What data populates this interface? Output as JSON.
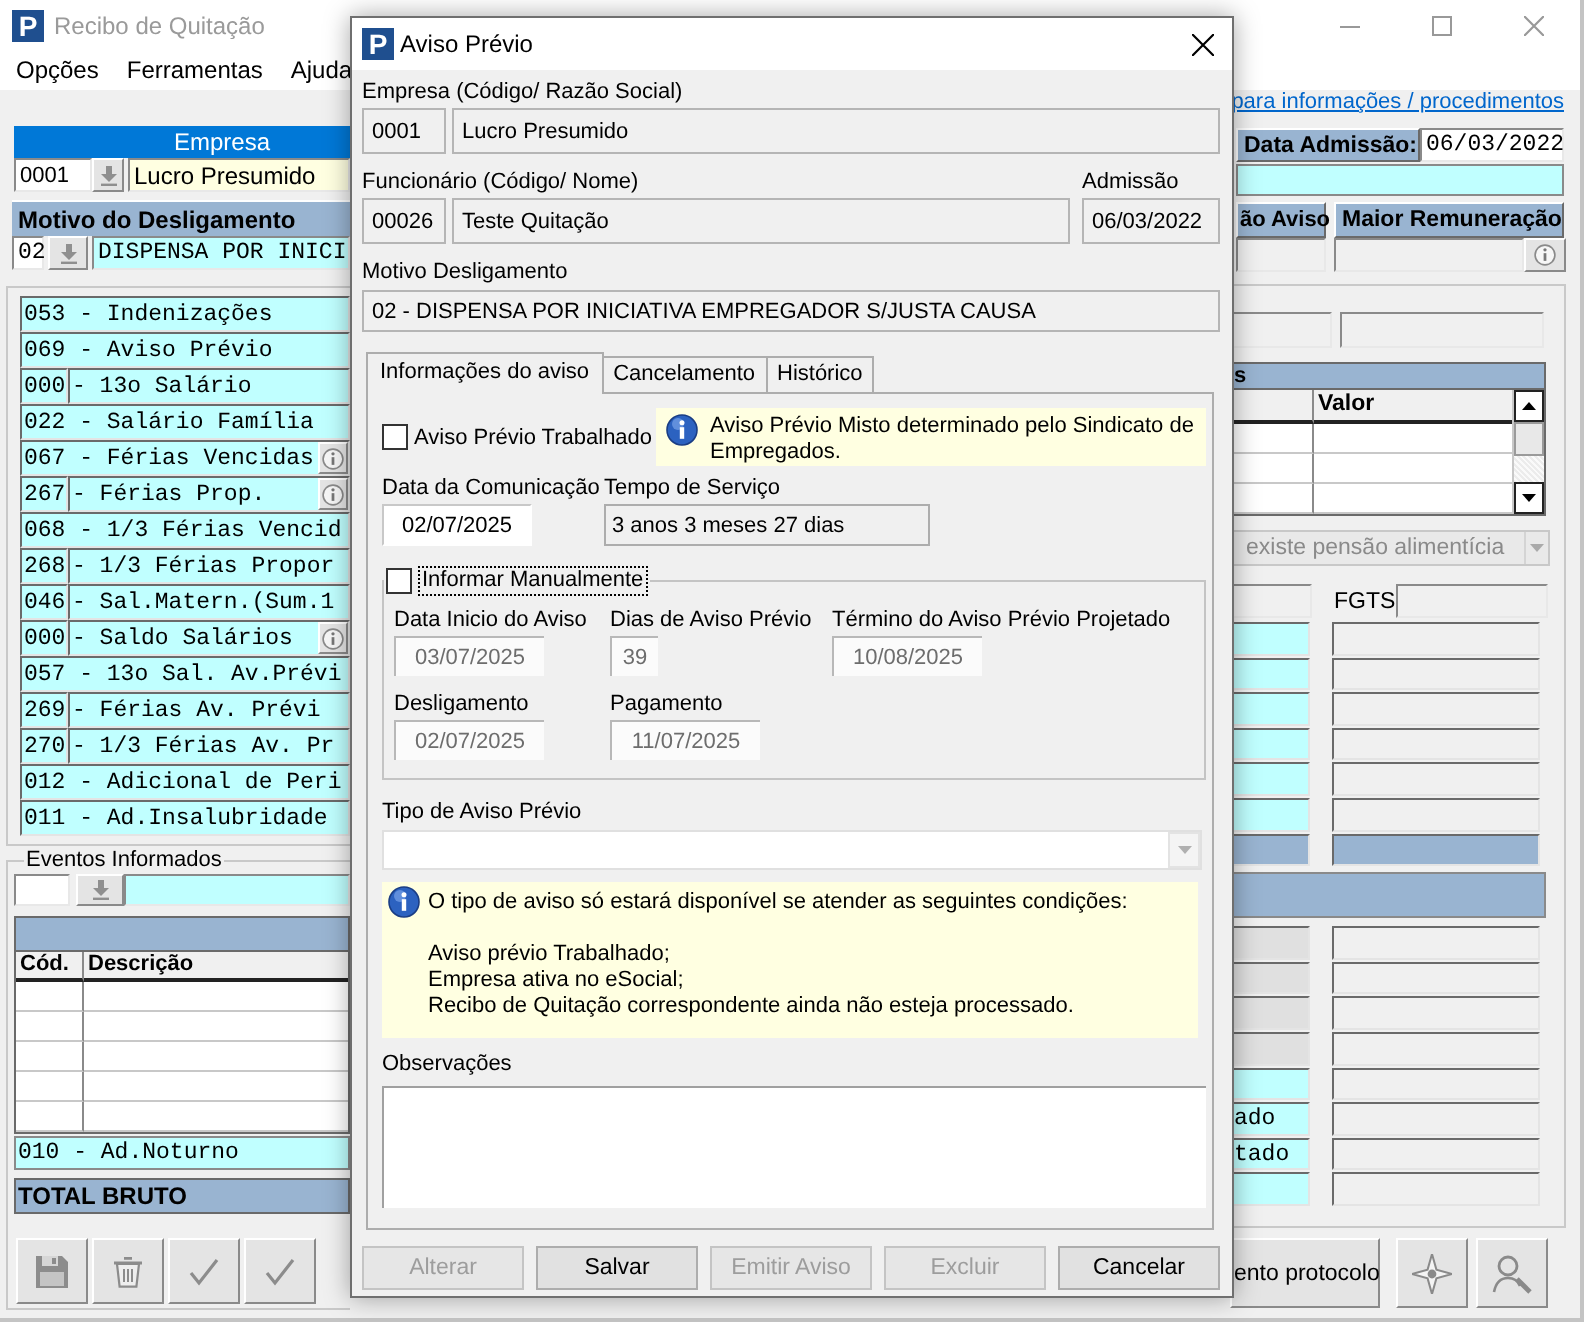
{
  "window": {
    "logo": "P",
    "title": "Recibo de Quitação",
    "active": false,
    "menu": [
      "Opções",
      "Ferramentas",
      "Ajuda"
    ],
    "help_link": "para informações / procedimentos"
  },
  "empresa": {
    "header": "Empresa",
    "code": "0001",
    "name": "Lucro Presumido"
  },
  "admissao": {
    "label": "Data Admissão:",
    "value": "06/03/2022"
  },
  "motivo": {
    "header": "Motivo do Desligamento",
    "code": "02",
    "text": "DISPENSA POR INICI"
  },
  "aviso": {
    "header": "ão Aviso"
  },
  "remuneracao": {
    "header": "Maior Remuneração"
  },
  "eventos": [
    {
      "kind": "single",
      "text": "053 - Indenizações",
      "info_button": false
    },
    {
      "kind": "single",
      "text": "069 - Aviso Prévio",
      "info_button": false
    },
    {
      "kind": "split",
      "code": "000",
      "text": "- 13o Salário",
      "info_button": false
    },
    {
      "kind": "single",
      "text": "022 - Salário Família",
      "info_button": false
    },
    {
      "kind": "single",
      "text": "067 - Férias Vencidas",
      "info_button": true
    },
    {
      "kind": "split",
      "code": "267",
      "text": "- Férias Prop.",
      "info_button": true
    },
    {
      "kind": "single",
      "text": "068 - 1/3 Férias Vencid",
      "info_button": false
    },
    {
      "kind": "split",
      "code": "268",
      "text": "- 1/3 Férias Propor",
      "info_button": false
    },
    {
      "kind": "split",
      "code": "046",
      "text": "- Sal.Matern.(Sum.1",
      "info_button": false
    },
    {
      "kind": "split",
      "code": "000",
      "text": "- Saldo Salários",
      "info_button": true
    },
    {
      "kind": "single",
      "text": "057 - 13o Sal. Av.Prévi",
      "info_button": false
    },
    {
      "kind": "split",
      "code": "269",
      "text": "- Férias Av. Prévi",
      "info_button": false
    },
    {
      "kind": "split",
      "code": "270",
      "text": "- 1/3 Férias Av. Pr",
      "info_button": false
    },
    {
      "kind": "single",
      "text": "012 - Adicional de Peri",
      "info_button": false
    },
    {
      "kind": "single",
      "text": "011 - Ad.Insalubridade",
      "info_button": false
    }
  ],
  "eventos_informados": {
    "legend": "Eventos Informados",
    "columns": [
      "Cód.",
      "Descrição"
    ],
    "selected_event": "010 - Ad.Noturno",
    "total_label": "TOTAL BRUTO"
  },
  "toolbar": [
    {
      "kind": "save",
      "disabled": true
    },
    {
      "kind": "trash",
      "disabled": true
    },
    {
      "kind": "confirm",
      "disabled": true
    },
    {
      "kind": "confirm",
      "disabled": true
    }
  ],
  "dependentes": {
    "header": "s",
    "columns": [
      "Valor"
    ]
  },
  "pensao": {
    "value": "existe pensão alimentícia",
    "disabled": true
  },
  "fgts": {
    "label": "FGTS"
  },
  "proventos_rows": [
    {
      "kind": "highlight"
    },
    {
      "kind": "highlight"
    },
    {
      "kind": "highlight"
    },
    {
      "kind": "highlight"
    },
    {
      "kind": "highlight"
    },
    {
      "kind": "highlight"
    },
    {
      "kind": "total"
    }
  ],
  "descontos_rows": [
    {
      "kind": "shaded"
    },
    {
      "kind": "shaded"
    },
    {
      "kind": "shaded"
    },
    {
      "kind": "shaded"
    },
    {
      "kind": "highlight"
    },
    {
      "kind": "highlight",
      "text": "ado"
    },
    {
      "kind": "highlight",
      "text": "tado"
    },
    {
      "kind": "highlight"
    }
  ],
  "actions": [
    {
      "kind": "text",
      "label": "ento protocolo"
    },
    {
      "kind": "star"
    },
    {
      "kind": "person_search"
    }
  ],
  "dialog": {
    "logo": "P",
    "title": "Aviso Prévio",
    "active": true,
    "empresa": {
      "label": "Empresa (Código/ Razão Social)",
      "code": "0001",
      "name": "Lucro Presumido",
      "readonly": true
    },
    "funcionario": {
      "label": "Funcionário (Código/ Nome)",
      "code": "00026",
      "name": "Teste Quitação",
      "readonly": true
    },
    "admissao": {
      "label": "Admissão",
      "value": "06/03/2022",
      "readonly": true
    },
    "motivo": {
      "label": "Motivo Desligamento",
      "value": "02 - DISPENSA POR INICIATIVA EMPREGADOR S/JUSTA CAUSA",
      "readonly": true
    },
    "tabs": [
      {
        "label": "Informações do aviso",
        "selected": true
      },
      {
        "label": "Cancelamento",
        "selected": false
      },
      {
        "label": "Histórico",
        "selected": false
      }
    ],
    "trabalhado": {
      "label": "Aviso Prévio Trabalhado",
      "checked": false
    },
    "mixed_note": "Aviso Prévio Misto determinado pelo Sindicato de Empregados.",
    "comunicacao": {
      "label": "Data da Comunicação",
      "value": "02/07/2025",
      "readonly": false
    },
    "tempo_servico": {
      "label": "Tempo de Serviço",
      "value": "3 anos 3 meses 27 dias",
      "readonly": true
    },
    "manual": {
      "label": "Informar Manualmente",
      "checked": false,
      "focused": true,
      "rows": [
        [
          {
            "kind": "date",
            "label": "Data Inicio do Aviso",
            "value": "03/07/2025",
            "disabled": true
          },
          {
            "kind": "number",
            "label": "Dias de Aviso Prévio",
            "value": "39",
            "disabled": true
          },
          {
            "kind": "date",
            "label": "Término do Aviso Prévio Projetado",
            "value": "10/08/2025",
            "disabled": true
          }
        ],
        [
          {
            "kind": "date",
            "label": "Desligamento",
            "value": "02/07/2025",
            "disabled": true
          },
          {
            "kind": "date",
            "label": "Pagamento",
            "value": "11/07/2025",
            "disabled": true
          }
        ]
      ]
    },
    "tipo": {
      "label": "Tipo de Aviso Prévio",
      "disabled": true
    },
    "conditions": {
      "intro": "O tipo de aviso só estará disponível se atender as seguintes condições:",
      "items": [
        "Aviso prévio Trabalhado;",
        "Empresa ativa no eSocial;",
        "Recibo de Quitação correspondente ainda não esteja processado."
      ]
    },
    "observacoes": {
      "label": "Observações"
    },
    "buttons": [
      {
        "label": "Alterar",
        "disabled": true
      },
      {
        "label": "Salvar",
        "disabled": false
      },
      {
        "label": "Emitir Aviso",
        "disabled": true
      },
      {
        "label": "Excluir",
        "disabled": true
      },
      {
        "label": "Cancelar",
        "disabled": false
      }
    ]
  }
}
